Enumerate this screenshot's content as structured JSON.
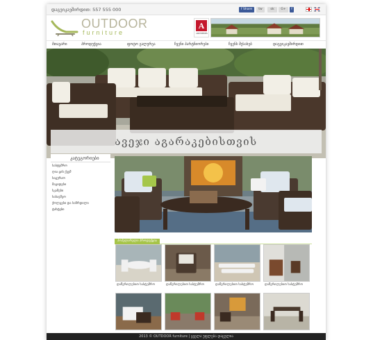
{
  "topbar": {
    "phone": "დაგვიკავშირდით: 557 555 000",
    "social": {
      "facebook": "f Share",
      "twitter": "tw",
      "ok": "ok",
      "google": "G+",
      "f": "f"
    }
  },
  "header": {
    "logo_top": "OUTDOOR",
    "logo_bottom": "furniture",
    "partner_letter": "A",
    "partner_text": "ARCHIMEDES"
  },
  "nav": {
    "items": [
      "მთავარი",
      "პროდუქცია",
      "ფოტო გალერეა",
      "ჩვენი პარტნიორები",
      "ჩვენს შესახებ",
      "დაგვიკავშირდით"
    ]
  },
  "hero": {
    "caption": "ავეჯი აგარაკებისთვის"
  },
  "sidebar": {
    "title": "კატეგორიები",
    "items": [
      "სასტუმრო",
      "ღია ცის ქვეშ",
      "საცურაო",
      "მაგიდები",
      "სკამები",
      "საბავშვო",
      "ქოლგები და საჩრდილი",
      "ტახტები"
    ]
  },
  "main": {
    "section_tab": "პოპულარული პროდუქცია",
    "thumb_label": "დაწვრილებით სასტუმრო"
  },
  "footer": {
    "text": "2013 © OUTDOOR furniture | ყველა უფლება დაცულია"
  },
  "colors": {
    "accent_green": "#a6c449",
    "logo_tan": "#b7b49c",
    "footer": "#222222"
  }
}
